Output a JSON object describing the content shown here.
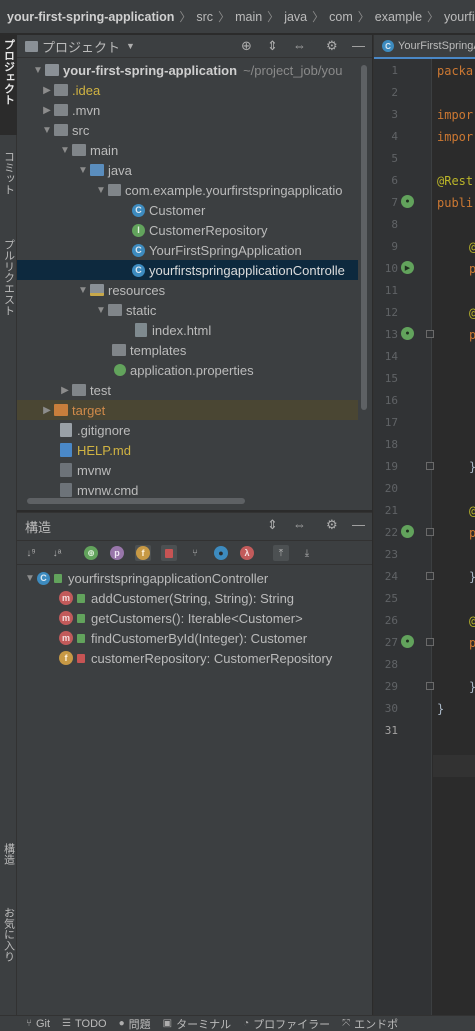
{
  "breadcrumb": [
    "your-first-spring-application",
    "src",
    "main",
    "java",
    "com",
    "example",
    "yourfirstsprin"
  ],
  "left_strip": {
    "project": "プロジェクト",
    "commit": "コミット",
    "pull_requests": "プルリクエスト",
    "structure": "構造",
    "favorites": "お気に入り"
  },
  "project_panel": {
    "title": "プロジェクト",
    "tree": [
      {
        "label": "your-first-spring-application",
        "suffix": "~/project_job/you"
      },
      {
        "label": ".idea"
      },
      {
        "label": ".mvn"
      },
      {
        "label": "src"
      },
      {
        "label": "main"
      },
      {
        "label": "java"
      },
      {
        "label": "com.example.yourfirstspringapplicatio"
      },
      {
        "label": "Customer"
      },
      {
        "label": "CustomerRepository"
      },
      {
        "label": "YourFirstSpringApplication"
      },
      {
        "label": "yourfirstspringapplicationControlle"
      },
      {
        "label": "resources"
      },
      {
        "label": "static"
      },
      {
        "label": "index.html"
      },
      {
        "label": "templates"
      },
      {
        "label": "application.properties"
      },
      {
        "label": "test"
      },
      {
        "label": "target"
      },
      {
        "label": ".gitignore"
      },
      {
        "label": "HELP.md"
      },
      {
        "label": "mvnw"
      },
      {
        "label": "mvnw.cmd"
      }
    ]
  },
  "structure_panel": {
    "title": "構造",
    "root": "yourfirstspringapplicationController",
    "members": [
      {
        "kind": "m",
        "label": "addCustomer(String, String): String"
      },
      {
        "kind": "m",
        "label": "getCustomers(): Iterable<Customer>"
      },
      {
        "kind": "m",
        "label": "findCustomerById(Integer): Customer"
      },
      {
        "kind": "f",
        "label": "customerRepository: CustomerRepository"
      }
    ]
  },
  "editor": {
    "tab": "YourFirstSpringAp",
    "line_numbers": [
      "1",
      "2",
      "3",
      "4",
      "5",
      "6",
      "7",
      "8",
      "9",
      "10",
      "11",
      "12",
      "13",
      "14",
      "15",
      "16",
      "17",
      "18",
      "19",
      "20",
      "21",
      "22",
      "23",
      "24",
      "25",
      "26",
      "27",
      "28",
      "29",
      "30",
      "31"
    ],
    "code": {
      "l1": "packa",
      "l3": "impor",
      "l4": "impor",
      "l6": "@Rest",
      "l7": "publi",
      "l9": "@",
      "l10": "p",
      "l12": "@",
      "l13": "p",
      "l19": "}",
      "l21": "@",
      "l22": "p",
      "l24": "}",
      "l26": "@",
      "l27": "p",
      "l29": "}",
      "l30": "}"
    }
  },
  "status_bar": [
    "Git",
    "TODO",
    "問題",
    "ターミナル",
    "プロファイラー",
    "エンドポ"
  ]
}
